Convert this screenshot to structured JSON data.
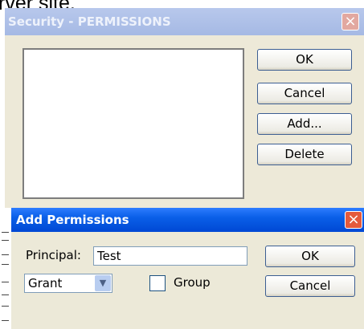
{
  "background": {
    "text": "rver site."
  },
  "security_dialog": {
    "title": "Security - PERMISSIONS",
    "close_label": "×",
    "buttons": {
      "ok": "OK",
      "cancel": "Cancel",
      "add": "Add...",
      "delete": "Delete"
    }
  },
  "add_permissions_dialog": {
    "title": "Add Permissions",
    "close_label": "×",
    "principal_label": "Principal:",
    "principal_value": "Test",
    "type_selected": "Grant",
    "group_label": "Group",
    "group_checked": false,
    "buttons": {
      "ok": "OK",
      "cancel": "Cancel"
    }
  },
  "colors": {
    "inactive_titlebar": "#a5b9e4",
    "active_titlebar": "#0a5fe8",
    "dialog_face": "#ece9d8",
    "close_active": "#e45a3c"
  }
}
